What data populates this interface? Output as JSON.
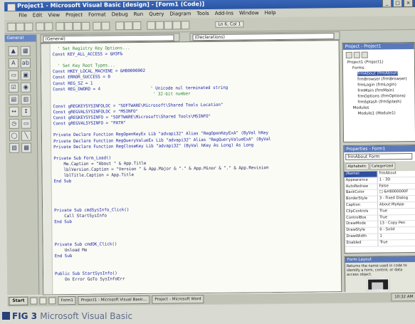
{
  "window": {
    "title": "Project1 - Microsoft Visual Basic [design] - [Form1 (Code)]",
    "min": "_",
    "max": "□",
    "close": "×"
  },
  "menu": [
    "File",
    "Edit",
    "View",
    "Project",
    "Format",
    "Debug",
    "Run",
    "Query",
    "Diagram",
    "Tools",
    "Add-Ins",
    "Window",
    "Help"
  ],
  "toolbar": {
    "position_readout": "Ln 6, Col 1"
  },
  "toolbox": {
    "title": "General",
    "tools": [
      "▲",
      "▦",
      "A",
      "ab",
      "▭",
      "▣",
      "☑",
      "◉",
      "▤",
      "▥",
      "↔",
      "↕",
      "◷",
      "▭",
      "◯",
      "╲",
      "▨",
      "▩"
    ]
  },
  "code_window": {
    "object_combo": "(General)",
    "proc_combo": "(Declarations)",
    "lines": [
      {
        "t": "  ' Set Registry Key Options...",
        "c": "cm"
      },
      {
        "t": "Const KEY_ALL_ACCESS = &H3F&",
        "c": "kw"
      },
      {
        "t": "",
        "c": ""
      },
      {
        "t": "  ' Set Key Root Types...",
        "c": "cm"
      },
      {
        "t": "Const HKEY_LOCAL_MACHINE = &H80000002",
        "c": "kw"
      },
      {
        "t": "Const ERROR_SUCCESS = 0",
        "c": "kw"
      },
      {
        "t": "Const REG_SZ = 1",
        "c": "kw"
      },
      {
        "t": "Const REG_DWORD = 4                    ' Unicode nul terminated string",
        "c": "kw"
      },
      {
        "t": "                                        ' 32-bit number",
        "c": "cm"
      },
      {
        "t": "",
        "c": ""
      },
      {
        "t": "Const gREGKEYSYSINFOLOC = \"SOFTWARE\\Microsoft\\Shared Tools Location\"",
        "c": "kw"
      },
      {
        "t": "Const gREGVALSYSINFOLOC = \"MSINFO\"",
        "c": "kw"
      },
      {
        "t": "Const gREGKEYSYSINFO = \"SOFTWARE\\Microsoft\\Shared Tools\\MSINFO\"",
        "c": "kw"
      },
      {
        "t": "Const gREGVALSYSINFO = \"PATH\"",
        "c": "kw"
      },
      {
        "t": "",
        "c": ""
      },
      {
        "t": "Private Declare Function RegOpenKeyEx Lib \"advapi32\" Alias \"RegOpenKeyExA\" (ByVal hKey",
        "c": "kw"
      },
      {
        "t": "Private Declare Function RegQueryValueEx Lib \"advapi32\" Alias \"RegQueryValueExA\" (ByVal",
        "c": "kw"
      },
      {
        "t": "Private Declare Function RegCloseKey Lib \"advapi32\" (ByVal hKey As Long) As Long",
        "c": "kw"
      },
      {
        "t": "",
        "c": ""
      },
      {
        "t": "Private Sub Form_Load()",
        "c": "kw"
      },
      {
        "t": "    Me.Caption = \"About \" & App.Title",
        "c": ""
      },
      {
        "t": "    lblVersion.Caption = \"Version \" & App.Major & \".\" & App.Minor & \".\" & App.Revision",
        "c": ""
      },
      {
        "t": "    lblTitle.Caption = App.Title",
        "c": ""
      },
      {
        "t": "End Sub",
        "c": "kw"
      },
      {
        "t": "",
        "c": ""
      },
      {
        "t": "",
        "c": ""
      },
      {
        "t": "",
        "c": ""
      },
      {
        "t": "",
        "c": ""
      },
      {
        "t": "Private Sub cmdSysInfo_Click()",
        "c": "kw"
      },
      {
        "t": "    Call StartSysInfo",
        "c": ""
      },
      {
        "t": "End Sub",
        "c": "kw"
      },
      {
        "t": "",
        "c": ""
      },
      {
        "t": "",
        "c": ""
      },
      {
        "t": "",
        "c": ""
      },
      {
        "t": "Private Sub cmdOK_Click()",
        "c": "kw"
      },
      {
        "t": "    Unload Me",
        "c": ""
      },
      {
        "t": "End Sub",
        "c": "kw"
      },
      {
        "t": "",
        "c": ""
      },
      {
        "t": "",
        "c": ""
      },
      {
        "t": "Public Sub StartSysInfo()",
        "c": "kw"
      },
      {
        "t": "    On Error GoTo SysInfoErr",
        "c": ""
      }
    ]
  },
  "project_explorer": {
    "title": "Project - Project1",
    "nodes": [
      {
        "label": "Project1 (Project1)",
        "d": 0,
        "sel": false
      },
      {
        "label": "Forms",
        "d": 1,
        "sel": false
      },
      {
        "label": "frmAbout (frmAbout)",
        "d": 2,
        "sel": true
      },
      {
        "label": "frmBrowser (frmBrowser)",
        "d": 2,
        "sel": false
      },
      {
        "label": "frmLogin (frmLogin)",
        "d": 2,
        "sel": false
      },
      {
        "label": "frmMain (frmMain)",
        "d": 2,
        "sel": false
      },
      {
        "label": "frmOptions (frmOptions)",
        "d": 2,
        "sel": false
      },
      {
        "label": "frmSplash (frmSplash)",
        "d": 2,
        "sel": false
      },
      {
        "label": "Modules",
        "d": 1,
        "sel": false
      },
      {
        "label": "Module1 (Module1)",
        "d": 2,
        "sel": false
      }
    ]
  },
  "properties": {
    "title": "Properties - Form1",
    "object_combo": "frmAbout Form",
    "tabs": [
      "Alphabetic",
      "Categorized"
    ],
    "rows": [
      {
        "k": "(Name)",
        "v": "frmAbout",
        "sel": true
      },
      {
        "k": "Appearance",
        "v": "1 - 3D",
        "sel": false
      },
      {
        "k": "AutoRedraw",
        "v": "False",
        "sel": false
      },
      {
        "k": "BackColor",
        "v": "□ &H8000000F",
        "sel": false
      },
      {
        "k": "BorderStyle",
        "v": "3 - Fixed Dialog",
        "sel": false
      },
      {
        "k": "Caption",
        "v": "About MyApp",
        "sel": false
      },
      {
        "k": "ClipControls",
        "v": "True",
        "sel": false
      },
      {
        "k": "ControlBox",
        "v": "True",
        "sel": false
      },
      {
        "k": "DrawMode",
        "v": "13 - Copy Pen",
        "sel": false
      },
      {
        "k": "DrawStyle",
        "v": "0 - Solid",
        "sel": false
      },
      {
        "k": "DrawWidth",
        "v": "1",
        "sel": false
      },
      {
        "k": "Enabled",
        "v": "True",
        "sel": false
      }
    ]
  },
  "form_layout": {
    "title": "Form Layout",
    "desc": "Returns the name used in code to identify a form, control, or data access object."
  },
  "taskbar": {
    "start": "Start",
    "tasks": [
      "Form1",
      "Project1 - Microsoft Visual Basic...",
      "Project - Microsoft Word"
    ],
    "clock": "10:32 AM"
  },
  "caption": {
    "label": "FIG 3",
    "rest": "Microsoft Visual Basic"
  }
}
